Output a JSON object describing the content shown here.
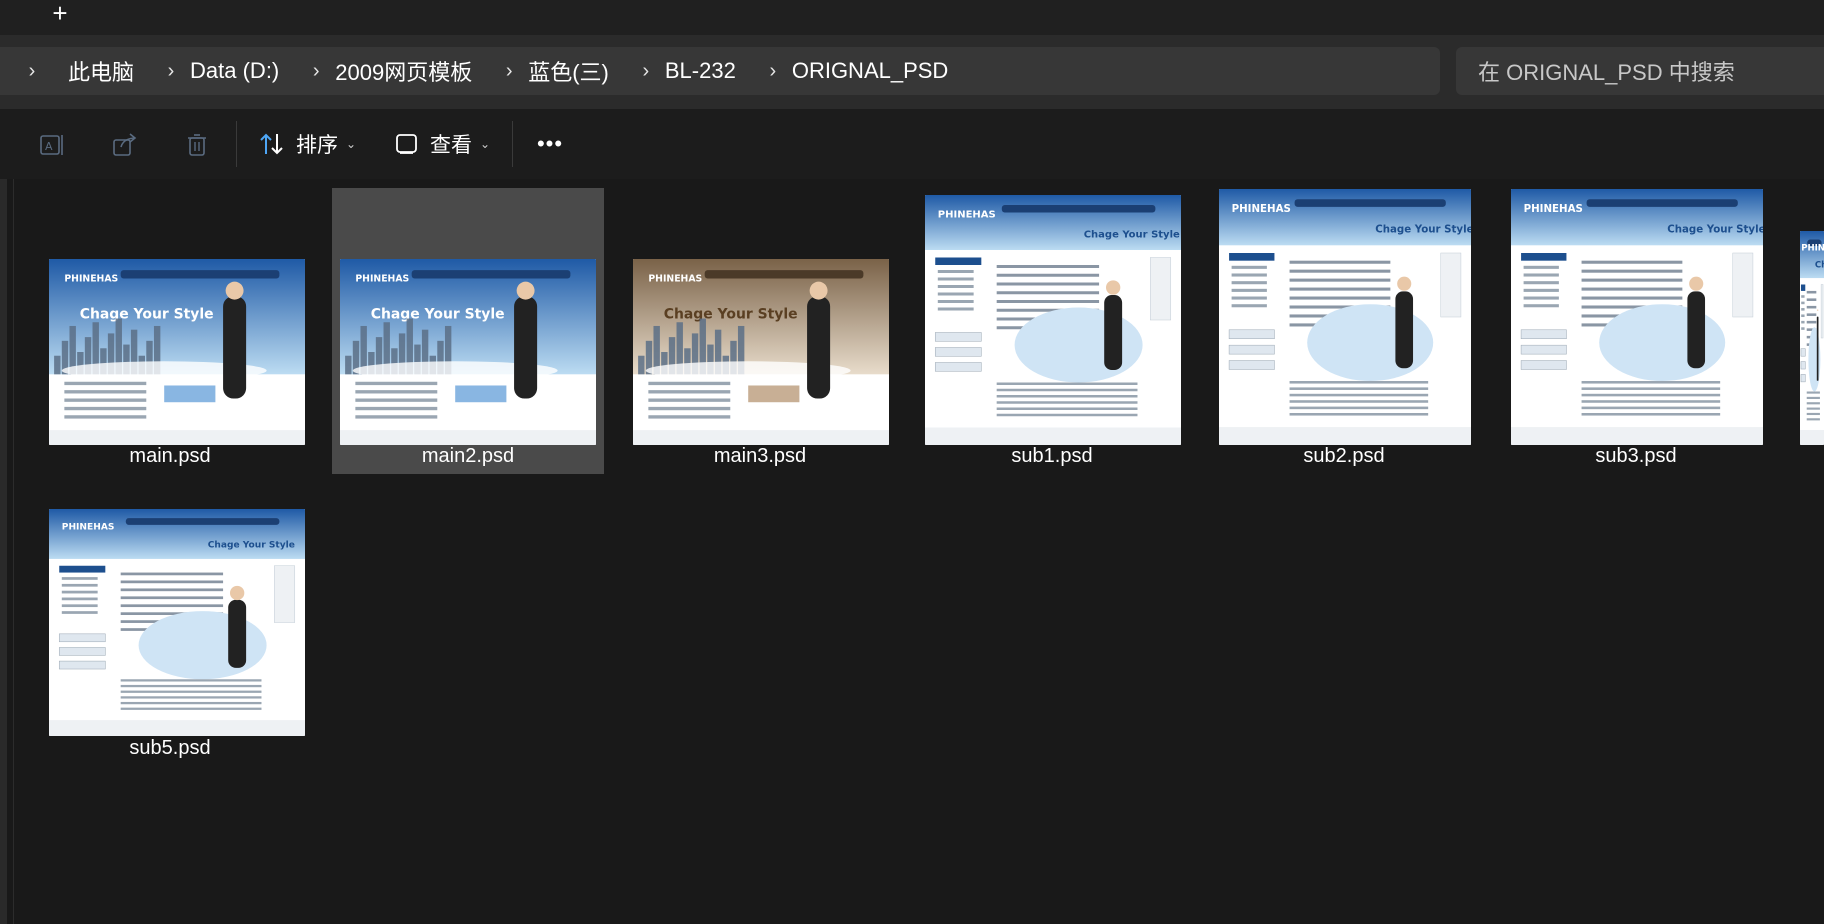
{
  "tabbar": {
    "new_tab_glyph": "+"
  },
  "breadcrumb": {
    "items": [
      "此电脑",
      "Data (D:)",
      "2009网页模板",
      "蓝色(三)",
      "BL-232",
      "ORIGNAL_PSD"
    ]
  },
  "search": {
    "placeholder": "在 ORIGNAL_PSD 中搜索"
  },
  "toolbar": {
    "rename_icon": "rename-icon",
    "share_icon": "share-icon",
    "delete_icon": "delete-icon",
    "sort_label": "排序",
    "view_label": "查看",
    "more_label": "•••"
  },
  "files": [
    {
      "name": "main.psd",
      "theme": "blue",
      "kind": "main",
      "selected": false
    },
    {
      "name": "main2.psd",
      "theme": "blue",
      "kind": "main",
      "selected": true
    },
    {
      "name": "main3.psd",
      "theme": "sepia",
      "kind": "main",
      "selected": false
    },
    {
      "name": "sub1.psd",
      "theme": "blue",
      "kind": "sub",
      "selected": false
    },
    {
      "name": "sub2.psd",
      "theme": "blue",
      "kind": "sub",
      "selected": false
    },
    {
      "name": "sub3.psd",
      "theme": "blue",
      "kind": "sub",
      "selected": false
    },
    {
      "name": "sub5.psd",
      "theme": "blue",
      "kind": "sub",
      "selected": false
    }
  ],
  "thumbnail_text": {
    "brand": "PHINEHAS",
    "slogan": "Chage Your Style"
  },
  "colors": {
    "window_bg": "#191919",
    "selection": "#4a4a4a",
    "sort_icon_accent": "#4ea6f5",
    "thumb_blue": "#2d6fb6",
    "thumb_sepia": "#8a6e4e"
  }
}
